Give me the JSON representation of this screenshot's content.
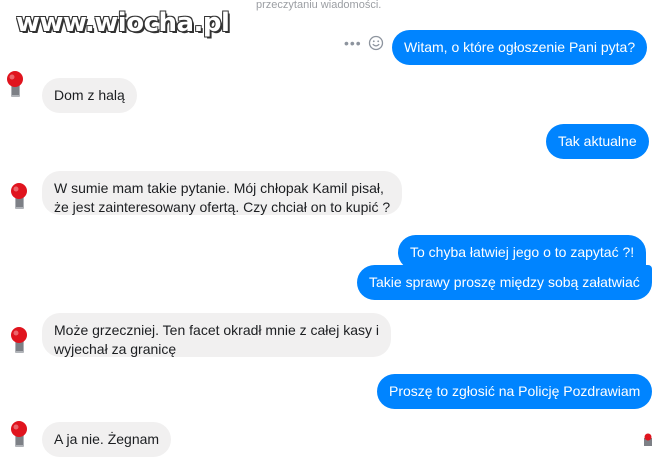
{
  "header": {
    "status_text": "przeczytaniu wiadomości.",
    "watermark": "www.wiocha.pl"
  },
  "messages": [
    {
      "side": "out",
      "text": "Witam, o które ogłoszenie Pani pyta?"
    },
    {
      "side": "in",
      "text": "Dom z halą"
    },
    {
      "side": "out",
      "text": "Tak aktualne"
    },
    {
      "side": "in",
      "lines": [
        "W sumie mam takie pytanie. Mój chłopak Kamil pisał,",
        "że jest zainteresowany ofertą. Czy chciał on to kupić ?"
      ]
    },
    {
      "side": "out",
      "text": "To chyba łatwiej jego o to zapytać ?!"
    },
    {
      "side": "out",
      "text": "Takie sprawy proszę między sobą załatwiać"
    },
    {
      "side": "in",
      "lines": [
        "Może grzeczniej. Ten facet okradł mnie z całej kasy i",
        "wyjechał za granicę"
      ]
    },
    {
      "side": "out",
      "text": "Proszę to zgłosić na Policję Pozdrawiam"
    },
    {
      "side": "in",
      "text": "A ja nie. Żegnam"
    }
  ],
  "icons": {
    "more": "more-dots-icon",
    "emoji": "smiley-icon",
    "avatar": "avatar-icon"
  },
  "colors": {
    "outgoing": "#0084ff",
    "incoming": "#f1f0f0",
    "avatar_red": "#e0141e"
  }
}
